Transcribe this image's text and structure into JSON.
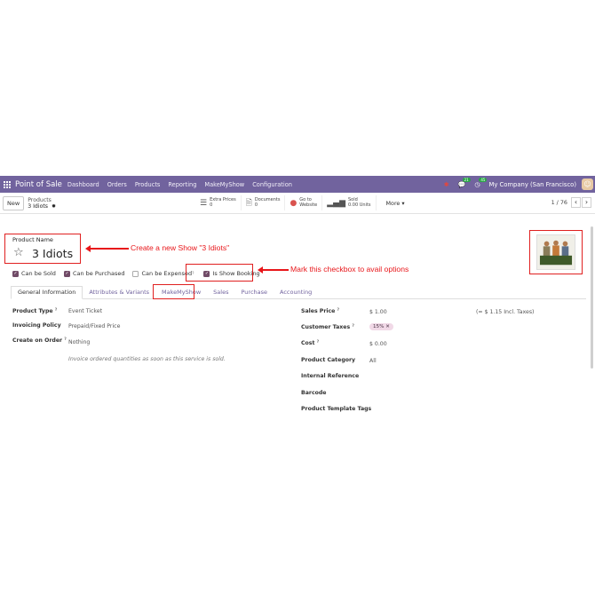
{
  "navbar": {
    "brand": "Point of Sale",
    "items": [
      "Dashboard",
      "Orders",
      "Products",
      "Reporting",
      "MakeMyShow",
      "Configuration"
    ],
    "badges": [
      "21",
      "45"
    ],
    "company": "My Company (San Francisco)",
    "color": "#71639e"
  },
  "control": {
    "new_label": "New",
    "breadcrumb_parent": "Products",
    "breadcrumb_current": "3 Idiots",
    "smart_buttons": [
      {
        "title": "Extra Prices",
        "value": "0",
        "icon": "list-icon"
      },
      {
        "title": "Documents",
        "value": "0",
        "icon": "document-icon"
      },
      {
        "title": "Go to",
        "value": "Website",
        "icon": "globe-icon"
      },
      {
        "title": "Sold",
        "value": "0.00 Units",
        "icon": "bar-chart-icon"
      }
    ],
    "more_label": "More",
    "pager": "1 / 76"
  },
  "product": {
    "name_label": "Product Name",
    "name": "3 Idiots",
    "image_alt_text": "3 idiots"
  },
  "annotations": {
    "name_note": "Create a new Show \"3 Idiots\"",
    "checkbox_note": "Mark this checkbox to avail options",
    "color": "#e8161a"
  },
  "checkboxes": [
    {
      "label": "Can be Sold",
      "checked": true
    },
    {
      "label": "Can be Purchased",
      "checked": true
    },
    {
      "label": "Can be Expensed",
      "checked": false,
      "help": "?"
    },
    {
      "label": "Is Show Booking",
      "checked": true
    }
  ],
  "tabs": [
    "General Information",
    "Attributes & Variants",
    "MakeMyShow",
    "Sales",
    "Purchase",
    "Accounting"
  ],
  "left_fields": {
    "product_type_label": "Product Type",
    "product_type": "Event Ticket",
    "invoicing_policy_label": "Invoicing Policy",
    "invoicing_policy": "Prepaid/Fixed Price",
    "create_on_order_label": "Create on Order",
    "create_on_order": "Nothing",
    "hint": "Invoice ordered quantities as soon as this service is sold."
  },
  "right_fields": {
    "sales_price_label": "Sales Price",
    "sales_price": "$ 1.00",
    "incl_taxes": "(= $ 1.15 Incl. Taxes)",
    "customer_taxes_label": "Customer Taxes",
    "customer_tax": "15%",
    "cost_label": "Cost",
    "cost": "$ 0.00",
    "category_label": "Product Category",
    "category": "All",
    "internal_ref_label": "Internal Reference",
    "barcode_label": "Barcode",
    "template_tags_label": "Product Template Tags"
  }
}
